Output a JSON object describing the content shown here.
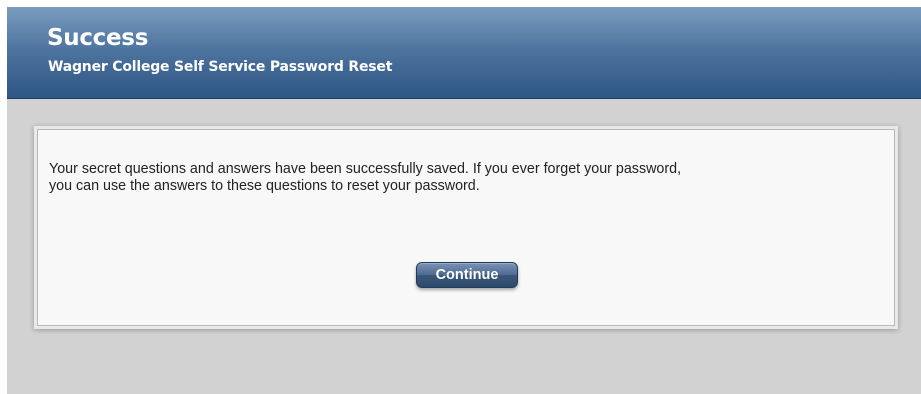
{
  "header": {
    "title": "Success",
    "subtitle": "Wagner College Self Service Password Reset"
  },
  "panel": {
    "message_line1": "Your secret questions and answers have been successfully saved. If you ever forget your password,",
    "message_line2": "you can use the answers to these questions to reset your password.",
    "continue_label": "Continue"
  },
  "colors": {
    "header_top": "#7b9cbf",
    "header_bottom": "#2e5684",
    "page_background": "#d2d2d2",
    "panel_background": "#f8f8f8",
    "button_background": "#3a5679"
  }
}
